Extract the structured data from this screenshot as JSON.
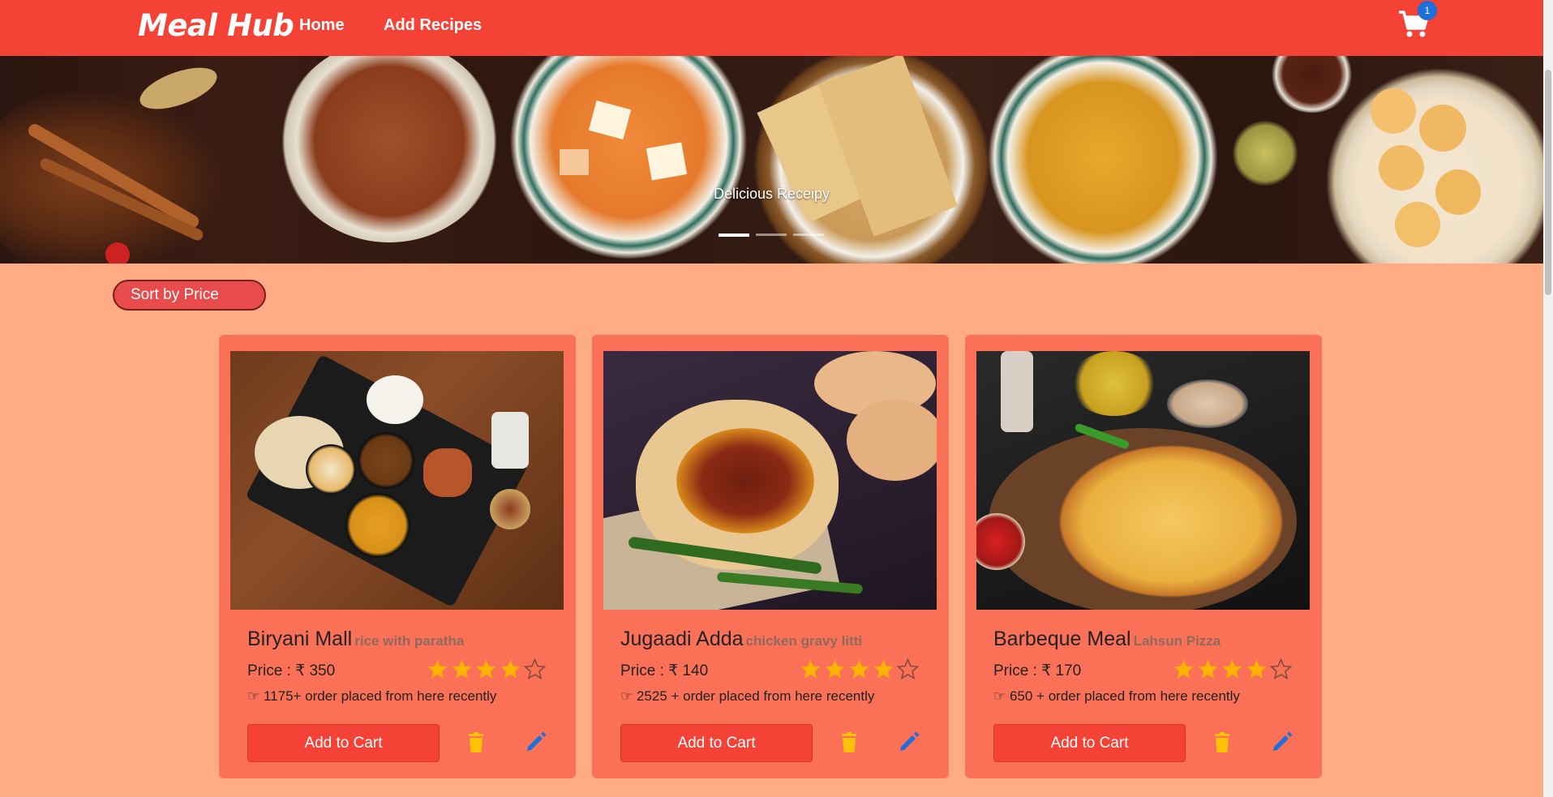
{
  "navbar": {
    "brand": "Meal Hub",
    "links": [
      "Home",
      "Add Recipes"
    ],
    "cart_count": "1"
  },
  "banner": {
    "caption": "Delicious Receipy",
    "slides": 3,
    "active_slide": 1
  },
  "sort": {
    "label": "Sort by Price"
  },
  "cards": [
    {
      "name": "Biryani Mall",
      "dish": "rice with paratha",
      "price": "Price : ₹ 350",
      "rating": 4,
      "max_rating": 5,
      "orders": "☞ 1175+ order placed from here recently",
      "add_label": "Add to Cart"
    },
    {
      "name": "Jugaadi Adda",
      "dish": "chicken gravy litti",
      "price": "Price : ₹ 140",
      "rating": 4,
      "max_rating": 5,
      "orders": "☞ 2525 + order placed from here recently",
      "add_label": "Add to Cart"
    },
    {
      "name": "Barbeque Meal",
      "dish": "Lahsun Pizza",
      "price": "Price : ₹ 170",
      "rating": 4,
      "max_rating": 5,
      "orders": "☞ 650 + order placed from here recently",
      "add_label": "Add to Cart"
    }
  ],
  "colors": {
    "navbar": "#f44336",
    "page_bg": "#ffab83",
    "card_bg": "#fb7158",
    "star": "#ffb300",
    "trash": "#ffc107",
    "edit": "#1e6fd9"
  }
}
